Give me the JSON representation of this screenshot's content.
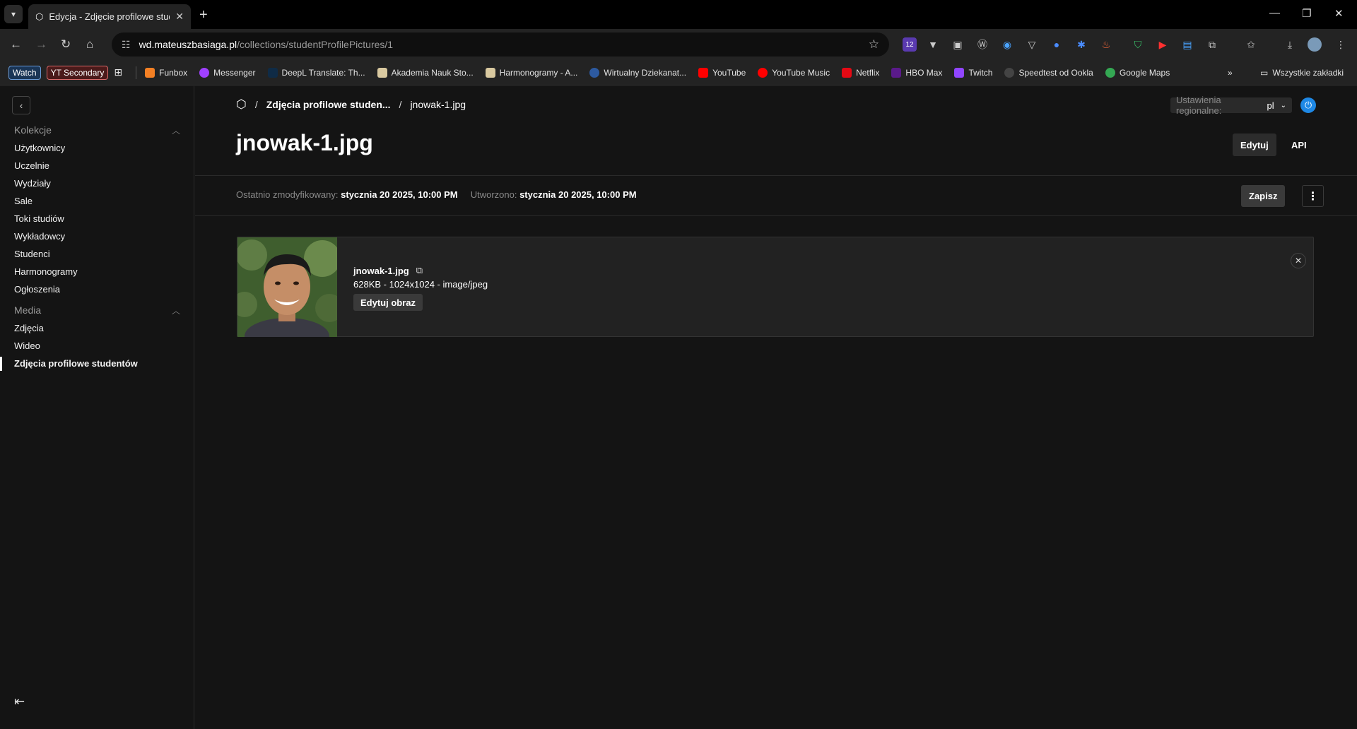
{
  "browser": {
    "tab_title": "Edycja - Zdjęcie profilowe studenta",
    "url_host": "wd.mateuszbasiaga.pl",
    "url_path": "/collections/studentProfilePictures/1",
    "extension_badge": "12",
    "bookmarks": {
      "badges": [
        "Watch",
        "YT Secondary"
      ],
      "items": [
        {
          "label": "Funbox",
          "color": "#f48024"
        },
        {
          "label": "Messenger",
          "color": "#a040ff"
        },
        {
          "label": "DeepL Translate: Th...",
          "color": "#0f2b46"
        },
        {
          "label": "Akademia Nauk Sto...",
          "color": "#d9c9a0"
        },
        {
          "label": "Harmonogramy - A...",
          "color": "#d9c9a0"
        },
        {
          "label": "Wirtualny Dziekanat...",
          "color": "#2d5aa0"
        },
        {
          "label": "YouTube",
          "color": "#ff0000"
        },
        {
          "label": "YouTube Music",
          "color": "#ff0000"
        },
        {
          "label": "Netflix",
          "color": "#e50914"
        },
        {
          "label": "HBO Max",
          "color": "#5a1a8a"
        },
        {
          "label": "Twitch",
          "color": "#9146ff"
        },
        {
          "label": "Speedtest od Ookla",
          "color": "#444444"
        },
        {
          "label": "Google Maps",
          "color": "#34a853"
        }
      ],
      "all_bookmarks": "Wszystkie zakładki"
    }
  },
  "sidebar": {
    "groups": [
      {
        "label": "Kolekcje",
        "items": [
          "Użytkownicy",
          "Uczelnie",
          "Wydziały",
          "Sale",
          "Toki studiów",
          "Wykładowcy",
          "Studenci",
          "Harmonogramy",
          "Ogłoszenia"
        ]
      },
      {
        "label": "Media",
        "items": [
          "Zdjęcia",
          "Wideo",
          "Zdjęcia profilowe studentów"
        ]
      }
    ],
    "active_item": "Zdjęcia profilowe studentów"
  },
  "header": {
    "breadcrumb": [
      "Zdjęcia profilowe studen...",
      "jnowak-1.jpg"
    ],
    "locale_label": "Ustawienia regionalne:",
    "locale_value": "pl"
  },
  "page": {
    "title": "jnowak-1.jpg",
    "tabs": [
      "Edytuj",
      "API"
    ],
    "active_tab": "Edytuj",
    "modified_label": "Ostatnio zmodyfikowany:",
    "modified_value": "stycznia 20 2025, 10:00 PM",
    "created_label": "Utworzono:",
    "created_value": "stycznia 20 2025, 10:00 PM",
    "save_label": "Zapisz"
  },
  "file": {
    "name": "jnowak-1.jpg",
    "info": "628KB - 1024x1024 - image/jpeg",
    "edit_label": "Edytuj obraz"
  },
  "colors": {
    "background": "#141414",
    "card": "#222222",
    "accent": "#1e88e5"
  }
}
